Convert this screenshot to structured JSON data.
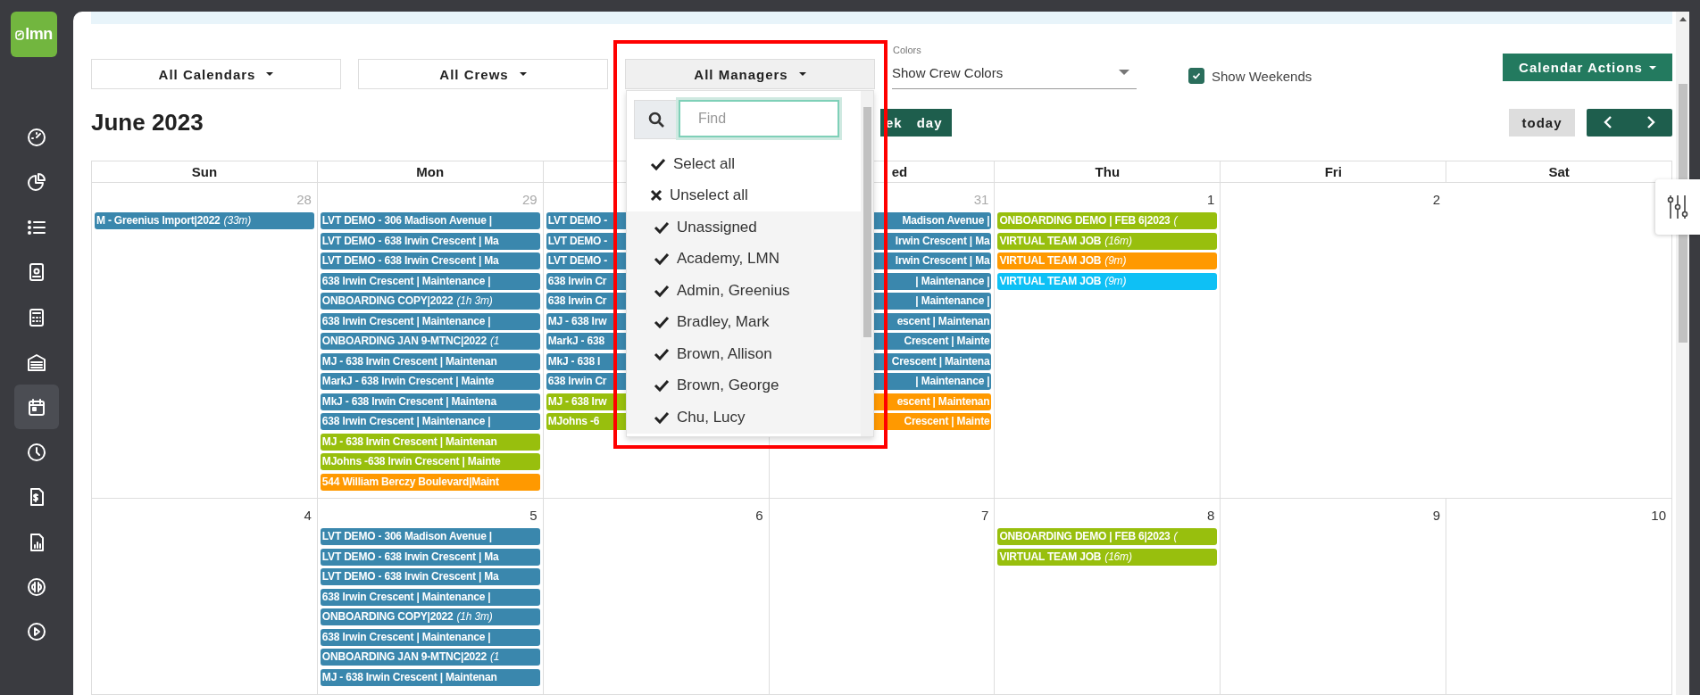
{
  "sidebar": {
    "logo": "lmn",
    "items": [
      {
        "selected": false
      },
      {
        "selected": false
      },
      {
        "selected": false
      },
      {
        "selected": false
      },
      {
        "selected": false
      },
      {
        "selected": false
      },
      {
        "selected": true
      },
      {
        "selected": false
      },
      {
        "selected": false
      },
      {
        "selected": false
      },
      {
        "selected": false
      },
      {
        "selected": false
      }
    ]
  },
  "filters": [
    {
      "label": "All Calendars",
      "open": false
    },
    {
      "label": "All Crews",
      "open": false
    },
    {
      "label": "All Managers",
      "open": true
    }
  ],
  "manager_menu": {
    "placeholder": "Find",
    "items": [
      {
        "kind": "select_all",
        "label": "Select all"
      },
      {
        "kind": "unselect_all",
        "label": "Unselect all"
      },
      {
        "kind": "option",
        "label": "Unassigned",
        "checked": true
      },
      {
        "kind": "option",
        "label": "Academy, LMN",
        "checked": true
      },
      {
        "kind": "option",
        "label": "Admin, Greenius",
        "checked": true
      },
      {
        "kind": "option",
        "label": "Bradley, Mark",
        "checked": true
      },
      {
        "kind": "option",
        "label": "Brown, Allison",
        "checked": true
      },
      {
        "kind": "option",
        "label": "Brown, George",
        "checked": true
      },
      {
        "kind": "option",
        "label": "Chu, Lucy",
        "checked": true
      }
    ]
  },
  "colors": {
    "label": "Colors",
    "value": "Show Crew Colors"
  },
  "show_weekends": {
    "label": "Show Weekends",
    "checked": true
  },
  "calendar_actions": "Calendar Actions",
  "title": "June 2023",
  "views": [
    {
      "label": "ek",
      "selected": false
    },
    {
      "label": "day",
      "selected": false
    }
  ],
  "today": "today",
  "weekdays": [
    {
      "label": "Sun"
    },
    {
      "label": "Mon"
    },
    {
      "label": "ed",
      "start_covered": true
    },
    {
      "label": "Thu"
    },
    {
      "label": "Fri"
    },
    {
      "label": "Sat"
    }
  ],
  "weeks": [
    {
      "days": [
        {
          "number": "28",
          "other_month": true,
          "events": [
            {
              "title": "M - Greenius Import|2022",
              "duration": "(33m)",
              "color": "#3a87ad"
            }
          ]
        },
        {
          "number": "29",
          "other_month": true,
          "events": [
            {
              "title": "LVT DEMO - 306 Madison Avenue |",
              "color": "#3a87ad"
            },
            {
              "title": "LVT DEMO - 638 Irwin Crescent | Ma",
              "color": "#3a87ad"
            },
            {
              "title": "LVT DEMO - 638 Irwin Crescent | Ma",
              "color": "#3a87ad"
            },
            {
              "title": "638 Irwin Crescent | Maintenance |",
              "color": "#3a87ad"
            },
            {
              "title": "ONBOARDING COPY|2022",
              "duration": "(1h 3m)",
              "color": "#3a87ad"
            },
            {
              "title": "638 Irwin Crescent | Maintenance |",
              "color": "#3a87ad"
            },
            {
              "title": "ONBOARDING JAN 9-MTNC|2022",
              "duration": "(1",
              "color": "#3a87ad"
            },
            {
              "title": "MJ - 638 Irwin Crescent | Maintenan",
              "color": "#3a87ad"
            },
            {
              "title": "MarkJ - 638 Irwin Crescent | Mainte",
              "color": "#3a87ad"
            },
            {
              "title": "MkJ - 638 Irwin Crescent | Maintena",
              "color": "#3a87ad"
            },
            {
              "title": "638 Irwin Crescent | Maintenance |",
              "color": "#3a87ad"
            },
            {
              "title": "MJ - 638 Irwin Crescent | Maintenan",
              "color": "#98bf0d"
            },
            {
              "title": "MJohns -638 Irwin Crescent | Mainte",
              "color": "#98bf0d"
            },
            {
              "title": "544 William Berczy Boulevard|Maint",
              "color": "#ff9900"
            }
          ]
        },
        {
          "events": [
            {
              "title": "LVT DEMO -",
              "color": "#3a87ad"
            },
            {
              "title": "LVT DEMO -",
              "color": "#3a87ad"
            },
            {
              "title": "LVT DEMO -",
              "color": "#3a87ad"
            },
            {
              "title": "638 Irwin Cr",
              "color": "#3a87ad"
            },
            {
              "title": "638 Irwin Cr",
              "color": "#3a87ad"
            },
            {
              "title": "MJ - 638 Irw",
              "color": "#3a87ad"
            },
            {
              "title": "MarkJ - 638",
              "color": "#3a87ad"
            },
            {
              "title": "MkJ - 638 I",
              "color": "#3a87ad"
            },
            {
              "title": "638 Irwin Cr",
              "color": "#3a87ad"
            },
            {
              "title": "MJ - 638 Irw",
              "color": "#98bf0d"
            },
            {
              "title": "MJohns -6",
              "color": "#98bf0d"
            }
          ]
        },
        {
          "number": "31",
          "other_month": true,
          "events": [
            {
              "title": "Madison Avenue |",
              "color": "#3a87ad",
              "start_covered": true
            },
            {
              "title": "Irwin Crescent | Ma",
              "color": "#3a87ad",
              "start_covered": true
            },
            {
              "title": "Irwin Crescent | Ma",
              "color": "#3a87ad",
              "start_covered": true
            },
            {
              "title": "| Maintenance |",
              "color": "#3a87ad",
              "start_covered": true
            },
            {
              "title": "| Maintenance |",
              "color": "#3a87ad",
              "start_covered": true
            },
            {
              "title": "escent | Maintenan",
              "color": "#3a87ad",
              "start_covered": true
            },
            {
              "title": "Crescent | Mainte",
              "color": "#3a87ad",
              "start_covered": true
            },
            {
              "title": "Crescent | Maintena",
              "color": "#3a87ad",
              "start_covered": true
            },
            {
              "title": "| Maintenance |",
              "color": "#3a87ad",
              "start_covered": true
            },
            {
              "title": "escent | Maintenan",
              "color": "#ff9900",
              "start_covered": true
            },
            {
              "title": "Crescent | Mainte",
              "color": "#ff9900",
              "start_covered": true
            }
          ]
        },
        {
          "number": "1",
          "other_month": false,
          "events": [
            {
              "title": "ONBOARDING DEMO | FEB 6|2023",
              "duration": "(",
              "color": "#98bf0d"
            },
            {
              "title": "VIRTUAL TEAM JOB",
              "duration": "(16m)",
              "color": "#98bf0d"
            },
            {
              "title": "VIRTUAL TEAM JOB",
              "duration": "(9m)",
              "color": "#ff9900"
            },
            {
              "title": "VIRTUAL TEAM JOB",
              "duration": "(9m)",
              "color": "#0ec0f5"
            }
          ]
        },
        {
          "number": "2",
          "other_month": false
        }
      ]
    },
    {
      "days": [
        {
          "number": "4",
          "other_month": false
        },
        {
          "number": "5",
          "other_month": false,
          "events": [
            {
              "title": "LVT DEMO - 306 Madison Avenue |",
              "color": "#3a87ad"
            },
            {
              "title": "LVT DEMO - 638 Irwin Crescent | Ma",
              "color": "#3a87ad"
            },
            {
              "title": "LVT DEMO - 638 Irwin Crescent | Ma",
              "color": "#3a87ad"
            },
            {
              "title": "638 Irwin Crescent | Maintenance |",
              "color": "#3a87ad"
            },
            {
              "title": "ONBOARDING COPY|2022",
              "duration": "(1h 3m)",
              "color": "#3a87ad"
            },
            {
              "title": "638 Irwin Crescent | Maintenance |",
              "color": "#3a87ad"
            },
            {
              "title": "ONBOARDING JAN 9-MTNC|2022",
              "duration": "(1",
              "color": "#3a87ad"
            },
            {
              "title": "MJ - 638 Irwin Crescent | Maintenan",
              "color": "#3a87ad"
            }
          ]
        },
        {
          "number": "6",
          "other_month": false
        },
        {
          "number": "7",
          "other_month": false
        },
        {
          "number": "8",
          "other_month": false,
          "events": [
            {
              "title": "ONBOARDING DEMO | FEB 6|2023",
              "duration": "(",
              "color": "#98bf0d"
            },
            {
              "title": "VIRTUAL TEAM JOB",
              "duration": "(16m)",
              "color": "#98bf0d"
            }
          ]
        },
        {
          "number": "9",
          "other_month": false
        },
        {
          "number": "10",
          "other_month": false
        }
      ]
    }
  ]
}
